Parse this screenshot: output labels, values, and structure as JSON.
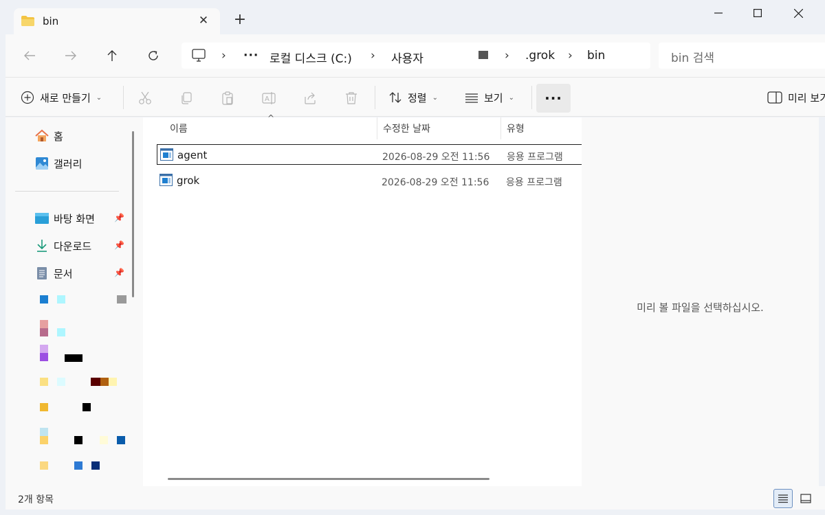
{
  "window": {
    "tab_title": "bin",
    "new_tab": "+"
  },
  "address": {
    "crumbs": [
      "로컬 디스크 (C:)",
      "사용자",
      ".grok",
      "bin"
    ],
    "ellipsis": "···",
    "search_placeholder": "bin 검색"
  },
  "toolbar": {
    "new_label": "새로 만들기",
    "sort_label": "정렬",
    "view_label": "보기",
    "more_label": "···",
    "preview_label": "미리 보기"
  },
  "sidebar": {
    "home": "홈",
    "gallery": "갤러리",
    "desktop": "바탕 화면",
    "downloads": "다운로드",
    "documents": "문서"
  },
  "columns": {
    "name": "이름",
    "modified": "수정한 날짜",
    "type": "유형"
  },
  "files": [
    {
      "name": "agent",
      "modified": "2026-08-29 오전 11:56",
      "type": "응용 프로그램"
    },
    {
      "name": "grok",
      "modified": "2026-08-29 오전 11:56",
      "type": "응용 프로그램"
    }
  ],
  "preview": {
    "empty_message": "미리 볼 파일을 선택하십시오."
  },
  "status": {
    "item_count": "2개 항목"
  },
  "colors": {
    "accent": "#0067c0",
    "folder": "#f3c443",
    "window_bg": "#eef1f6"
  }
}
